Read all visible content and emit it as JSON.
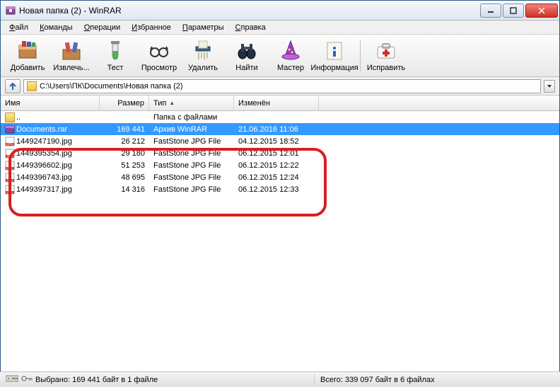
{
  "window": {
    "title": "Новая папка (2) - WinRAR"
  },
  "menu": {
    "file": "Файл",
    "commands": "Команды",
    "operations": "Операции",
    "favorites": "Избранное",
    "options": "Параметры",
    "help": "Справка"
  },
  "toolbar": {
    "add": "Добавить",
    "extract": "Извлечь...",
    "test": "Тест",
    "view": "Просмотр",
    "delete": "Удалить",
    "find": "Найти",
    "wizard": "Мастер",
    "info": "Информация",
    "repair": "Исправить"
  },
  "path": "C:\\Users\\ПК\\Documents\\Новая папка (2)",
  "columns": {
    "name": "Имя",
    "size": "Размер",
    "type": "Тип",
    "modified": "Изменён"
  },
  "rows": [
    {
      "name": "..",
      "size": "",
      "type": "Папка с файлами",
      "date": "",
      "icon": "folder",
      "selected": false
    },
    {
      "name": "Documents.rar",
      "size": "169 441",
      "type": "Архив WinRAR",
      "date": "21.06.2016 11:06",
      "icon": "rar",
      "selected": true
    },
    {
      "name": "1449247190.jpg",
      "size": "26 212",
      "type": "FastStone JPG File",
      "date": "04.12.2015 18:52",
      "icon": "jpg",
      "selected": false
    },
    {
      "name": "1449395354.jpg",
      "size": "29 180",
      "type": "FastStone JPG File",
      "date": "06.12.2015 12:01",
      "icon": "jpg",
      "selected": false
    },
    {
      "name": "1449396602.jpg",
      "size": "51 253",
      "type": "FastStone JPG File",
      "date": "06.12.2015 12:22",
      "icon": "jpg",
      "selected": false
    },
    {
      "name": "1449396743.jpg",
      "size": "48 695",
      "type": "FastStone JPG File",
      "date": "06.12.2015 12:24",
      "icon": "jpg",
      "selected": false
    },
    {
      "name": "1449397317.jpg",
      "size": "14 316",
      "type": "FastStone JPG File",
      "date": "06.12.2015 12:33",
      "icon": "jpg",
      "selected": false
    }
  ],
  "status": {
    "selected": "Выбрано: 169 441 байт в 1 файле",
    "total": "Всего: 339 097 байт в 6 файлах"
  }
}
